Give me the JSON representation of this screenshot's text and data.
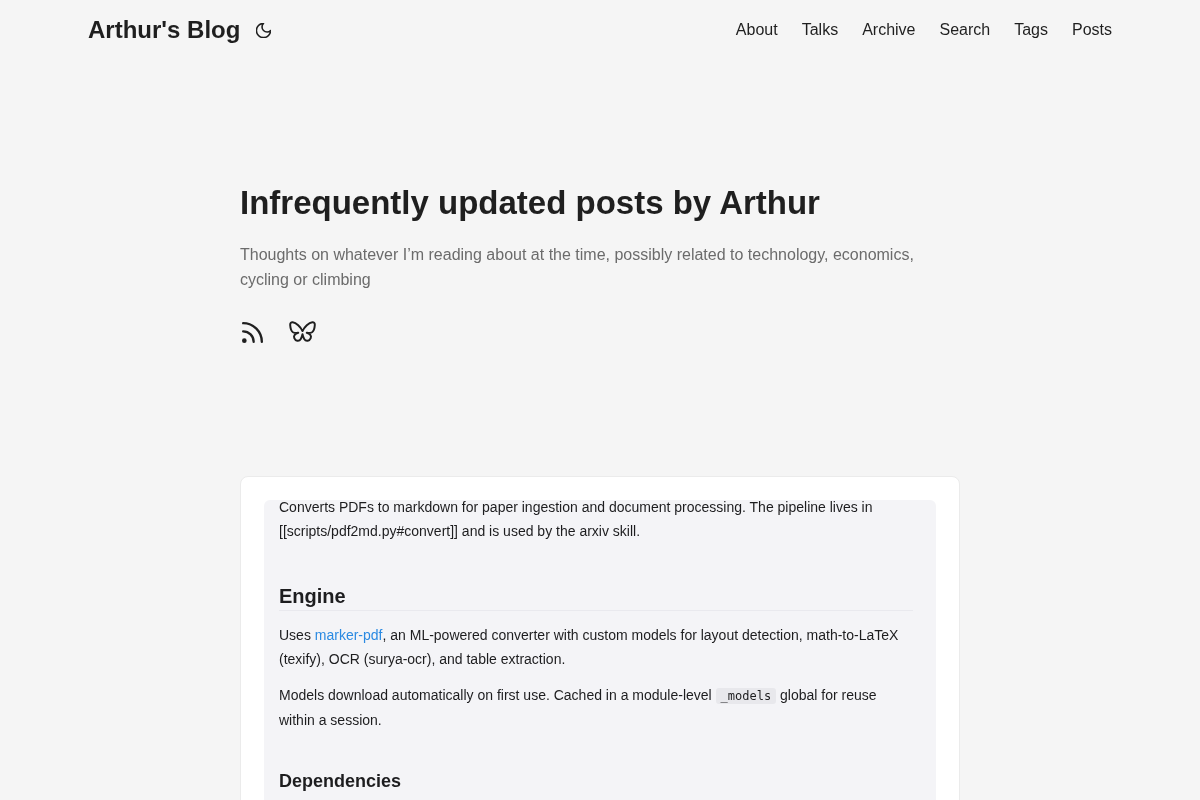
{
  "header": {
    "site_title": "Arthur's Blog",
    "nav": [
      "About",
      "Talks",
      "Archive",
      "Search",
      "Tags",
      "Posts"
    ]
  },
  "intro": {
    "title": "Infrequently updated posts by Arthur",
    "subtitle": "Thoughts on whatever I’m reading about at the time, possibly related to technology, economics, cycling or climbing"
  },
  "post_preview": {
    "blocks": [
      {
        "kind": "paragraph",
        "segments": [
          {
            "kind": "text",
            "text": "Converts PDFs to markdown for paper ingestion and document processing. The pipeline lives in [[scripts/pdf2md.py#convert]] and is used by the arxiv skill."
          }
        ]
      },
      {
        "kind": "heading",
        "segments": [
          {
            "kind": "text",
            "text": "Engine"
          }
        ]
      },
      {
        "kind": "paragraph",
        "segments": [
          {
            "kind": "text",
            "text": "Uses "
          },
          {
            "kind": "link",
            "text": "marker-pdf"
          },
          {
            "kind": "text",
            "text": ", an ML-powered converter with custom models for layout detection, math-to-LaTeX (texify), OCR (surya-ocr), and table extraction."
          }
        ]
      },
      {
        "kind": "paragraph",
        "segments": [
          {
            "kind": "text",
            "text": "Models download automatically on first use. Cached in a module-level "
          },
          {
            "kind": "code",
            "text": "_models"
          },
          {
            "kind": "text",
            "text": " global for reuse within a session."
          }
        ]
      },
      {
        "kind": "subheading",
        "segments": [
          {
            "kind": "text",
            "text": "Dependencies"
          }
        ]
      }
    ]
  }
}
